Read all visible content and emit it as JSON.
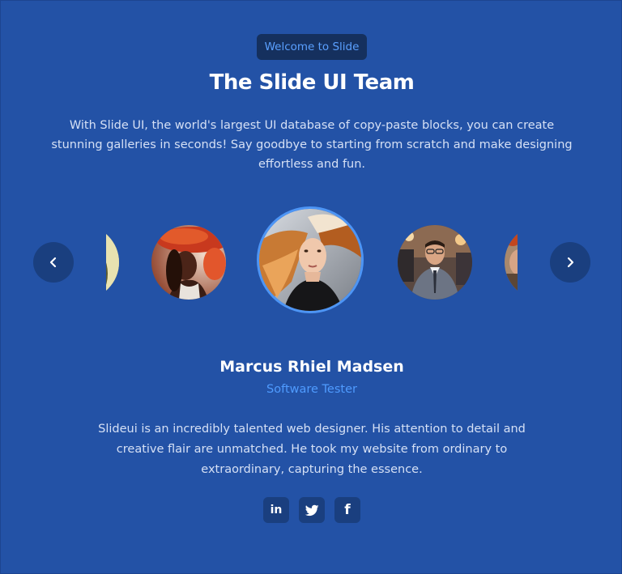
{
  "header": {
    "badge": "Welcome to Slide",
    "title": "The Slide UI Team",
    "intro": "With Slide UI, the world's largest UI database of copy-paste blocks, you can create stunning galleries in seconds! Say goodbye to starting from scratch and make designing effortless and fun."
  },
  "carousel": {
    "prev_icon": "chevron-left-icon",
    "next_icon": "chevron-right-icon",
    "active_index": 2,
    "member_count_visible": 5
  },
  "member": {
    "name": "Marcus Rhiel Madsen",
    "role": "Software Tester",
    "bio": "Slideui is an incredibly talented web designer. His attention to detail and creative flair are unmatched. He took my website from ordinary to extraordinary, capturing the essence."
  },
  "social": {
    "linkedin_glyph": "in",
    "linkedin_icon": "linkedin-icon",
    "twitter_icon": "twitter-icon",
    "facebook_glyph": "f",
    "facebook_icon": "facebook-icon"
  },
  "colors": {
    "background": "#2352a6",
    "badge_bg": "#15305e",
    "accent": "#4f9bff",
    "button_bg": "#1a3f7f",
    "active_ring": "#4d95f5"
  }
}
